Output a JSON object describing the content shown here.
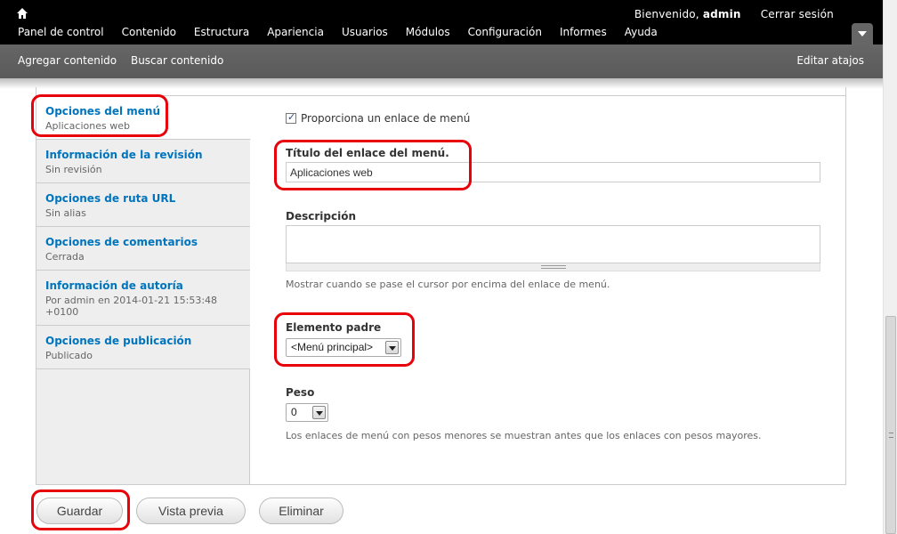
{
  "toolbar": {
    "welcome_prefix": "Bienvenido,",
    "username": "admin",
    "logout": "Cerrar sesión",
    "menu": [
      "Panel de control",
      "Contenido",
      "Estructura",
      "Apariencia",
      "Usuarios",
      "Módulos",
      "Configuración",
      "Informes",
      "Ayuda"
    ]
  },
  "shortcuts": {
    "items": [
      "Agregar contenido",
      "Buscar contenido"
    ],
    "edit": "Editar atajos"
  },
  "vertical_tabs": [
    {
      "title": "Opciones del menú",
      "summary": "Aplicaciones web",
      "active": true
    },
    {
      "title": "Información de la revisión",
      "summary": "Sin revisión"
    },
    {
      "title": "Opciones de ruta URL",
      "summary": "Sin alias"
    },
    {
      "title": "Opciones de comentarios",
      "summary": "Cerrada"
    },
    {
      "title": "Información de autoría",
      "summary": "Por admin en 2014-01-21 15:53:48 +0100"
    },
    {
      "title": "Opciones de publicación",
      "summary": "Publicado"
    }
  ],
  "menu_settings": {
    "checkbox_label": "Proporciona un enlace de menú",
    "checkbox_checked": true,
    "title_label": "Título del enlace del menú.",
    "title_value": "Aplicaciones web",
    "description_label": "Descripción",
    "description_value": "",
    "description_help": "Mostrar cuando se pase el cursor por encima del enlace de menú.",
    "parent_label": "Elemento padre",
    "parent_value": "<Menú principal>",
    "weight_label": "Peso",
    "weight_value": "0",
    "weight_help": "Los enlaces de menú con pesos menores se muestran antes que los enlaces con pesos mayores."
  },
  "actions": {
    "save": "Guardar",
    "preview": "Vista previa",
    "delete": "Eliminar"
  },
  "colors": {
    "toolbar_bg": "#000000",
    "shortcuts_bg": "#666666",
    "tab_link": "#0074bd",
    "highlight": "#e8000b"
  },
  "icons": {
    "home": "home-icon",
    "toggle": "chevron-down-icon",
    "resize": "resize-grip-icon"
  }
}
